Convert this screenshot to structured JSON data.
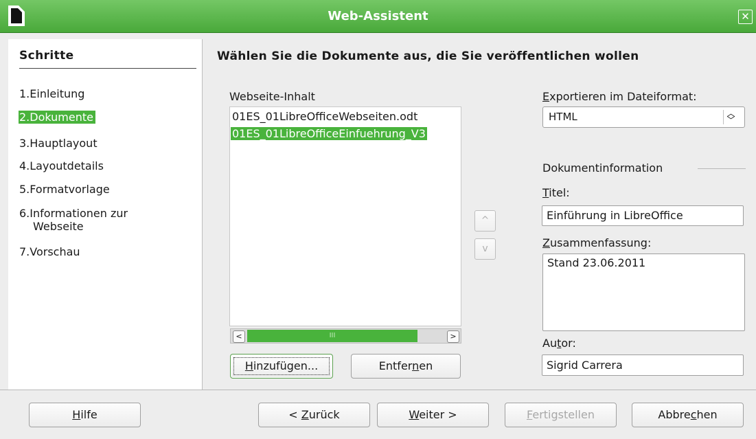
{
  "window": {
    "title": "Web-Assistent",
    "close_icon": "close-icon"
  },
  "steps": {
    "heading": "Schritte",
    "items": [
      {
        "num": "1.",
        "label": "Einleitung",
        "active": false
      },
      {
        "num": "2.",
        "label": "Dokumente",
        "active": true
      },
      {
        "num": "3.",
        "label": "Hauptlayout",
        "active": false
      },
      {
        "num": "4.",
        "label": "Layoutdetails",
        "active": false
      },
      {
        "num": "5.",
        "label": "Formatvorlage",
        "active": false
      },
      {
        "num": "6.",
        "label": "Informationen zur",
        "label2": "Webseite",
        "active": false
      },
      {
        "num": "7.",
        "label": "Vorschau",
        "active": false
      }
    ]
  },
  "main": {
    "heading": "Wählen Sie die Dokumente aus, die Sie veröffentlichen wollen",
    "content_label": "Webseite-Inhalt",
    "documents": [
      "01ES_01LibreOfficeWebseiten.odt",
      "01ES_01LibreOfficeEinfuehrung_V3"
    ],
    "selected_index": 1,
    "scroll_thumb": "III",
    "add_button": {
      "pre": "",
      "mnemonic": "H",
      "post": "inzufügen..."
    },
    "remove_button": {
      "pre": "Entfer",
      "mnemonic": "n",
      "post": "en"
    },
    "move_up": "^",
    "move_down": "v"
  },
  "export": {
    "label_mnemonic": "E",
    "label_rest": "xportieren im Dateiformat:",
    "format_value": "HTML"
  },
  "docinfo": {
    "heading": "Dokumentinformation",
    "title_label": {
      "mnemonic": "T",
      "rest": "itel:"
    },
    "title_value": "Einführung in LibreOffice",
    "summary_label": {
      "mnemonic": "Z",
      "rest": "usammenfassung:"
    },
    "summary_value": "Stand 23.06.2011",
    "author_label": {
      "pre": "Au",
      "mnemonic": "t",
      "rest": "or:"
    },
    "author_value": "Sigrid Carrera"
  },
  "footer": {
    "help": {
      "mnemonic": "H",
      "rest": "ilfe"
    },
    "back": {
      "pre": "< ",
      "mnemonic": "Z",
      "rest": "urück"
    },
    "next": {
      "mnemonic": "W",
      "rest": "eiter >"
    },
    "finish": {
      "mnemonic": "F",
      "rest": "ertigstellen"
    },
    "cancel": {
      "pre": "Abbre",
      "mnemonic": "c",
      "rest": "hen"
    }
  }
}
